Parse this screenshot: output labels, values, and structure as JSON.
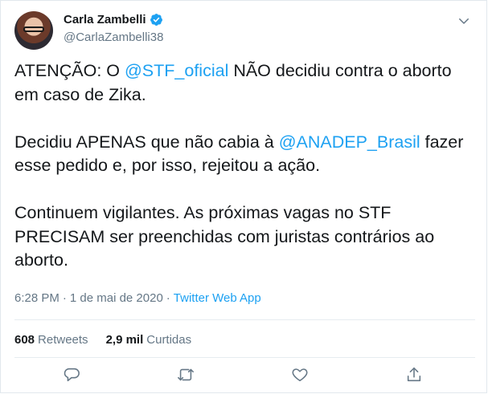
{
  "author": {
    "display_name": "Carla Zambelli",
    "handle": "@CarlaZambelli38"
  },
  "tweet": {
    "p1_pre": "ATENÇÃO: O ",
    "p1_mention": "@STF_oficial",
    "p1_post": " NÃO decidiu contra o aborto em caso de Zika.",
    "p2_pre": "Decidiu APENAS que não cabia à ",
    "p2_mention": "@ANADEP_Brasil",
    "p2_post": " fazer esse pedido e, por isso, rejeitou a ação.",
    "p3": "Continuem vigilantes. As próximas vagas no STF PRECISAM ser preenchidas com juristas contrários ao aborto."
  },
  "meta": {
    "time": "6:28 PM",
    "sep1": "·",
    "date": "1 de mai de 2020",
    "sep2": "·",
    "source": "Twitter Web App"
  },
  "stats": {
    "retweets_count": "608",
    "retweets_label": "Retweets",
    "likes_count": "2,9 mil",
    "likes_label": "Curtidas"
  },
  "icons": {
    "verified": "verified-badge-icon",
    "more": "chevron-down-icon",
    "reply": "reply-icon",
    "retweet": "retweet-icon",
    "like": "heart-icon",
    "share": "share-icon"
  },
  "colors": {
    "link": "#1da1f2",
    "muted": "#657786",
    "text": "#14171a"
  }
}
